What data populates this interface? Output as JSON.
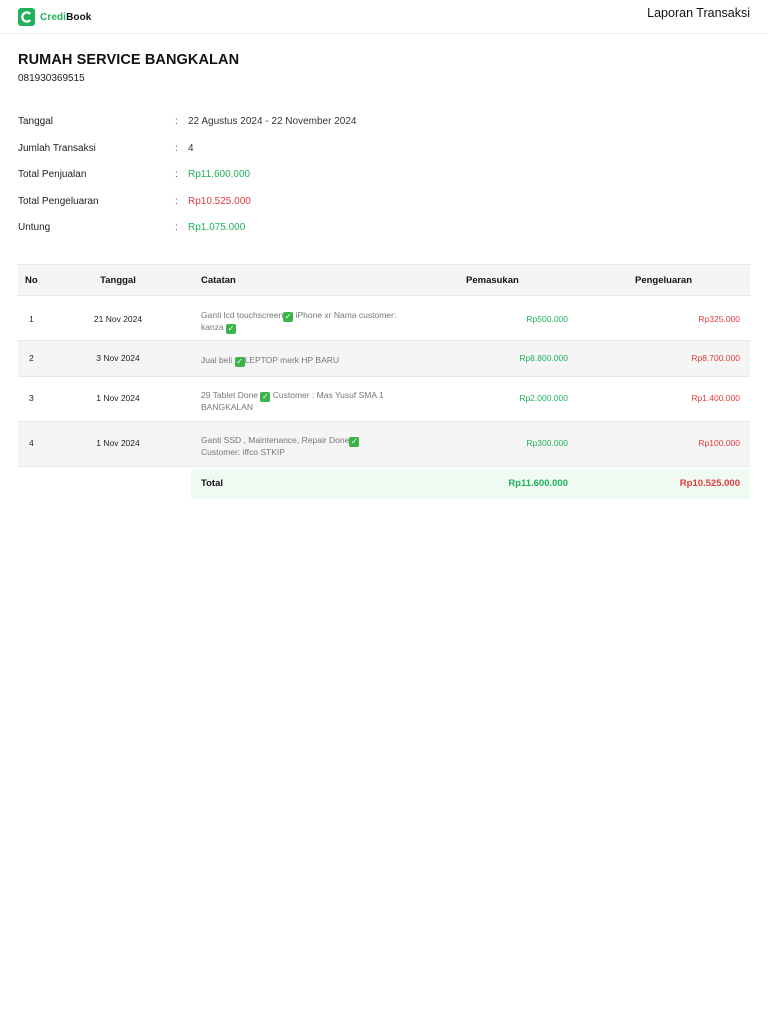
{
  "header": {
    "brand_first": "Credi",
    "brand_second": "Book",
    "report_title": "Laporan Transaksi",
    "brand_color": "#1fb25a"
  },
  "business": {
    "name": "RUMAH SERVICE BANGKALAN",
    "phone": "081930369515"
  },
  "summary": [
    {
      "label": "Tanggal",
      "value": "22 Agustus 2024 - 22 November 2024",
      "tone": "neutral"
    },
    {
      "label": "Jumlah Transaksi",
      "value": "4",
      "tone": "neutral"
    },
    {
      "label": "Total Penjualan",
      "value": "Rp11.600.000",
      "tone": "positive"
    },
    {
      "label": "Total Pengeluaran",
      "value": "Rp10.525.000",
      "tone": "negative"
    },
    {
      "label": "Untung",
      "value": "Rp1.075.000",
      "tone": "positive"
    }
  ],
  "table": {
    "columns": {
      "no": "No",
      "date": "Tanggal",
      "note": "Catatan",
      "income": "Pemasukan",
      "expense": "Pengeluaran"
    },
    "rows": [
      {
        "no": "1",
        "date": "21 Nov 2024",
        "note_a": "Ganti lcd touchscreen",
        "note_b": " iPhone xr Nama customer: kanza ",
        "note_c": "",
        "income": "Rp500.000",
        "expense": "Rp325.000"
      },
      {
        "no": "2",
        "date": "3 Nov 2024",
        "note_a": "Jual beli ",
        "note_b": "LEPTOP merk HP BARU",
        "note_c": "",
        "income": "Rp8.800.000",
        "expense": "Rp8.700.000"
      },
      {
        "no": "3",
        "date": "1 Nov 2024",
        "note_a": "29 Tablet Done ",
        "note_b": " Customer : Mas Yusuf SMA 1 BANGKALAN",
        "note_c": "",
        "income": "Rp2.000.000",
        "expense": "Rp1.400.000"
      },
      {
        "no": "4",
        "date": "1 Nov 2024",
        "note_a": "Ganti SSD , Maintenance, Repair Done",
        "note_b": "",
        "note_c": "Customer: iffco STKIP",
        "income": "Rp300.000",
        "expense": "Rp100.000"
      }
    ],
    "total": {
      "label": "Total",
      "income": "Rp11.600.000",
      "expense": "Rp10.525.000"
    },
    "colors": {
      "income": "#1fb25a",
      "expense": "#e23b3b",
      "check": "#3bb54a"
    }
  }
}
